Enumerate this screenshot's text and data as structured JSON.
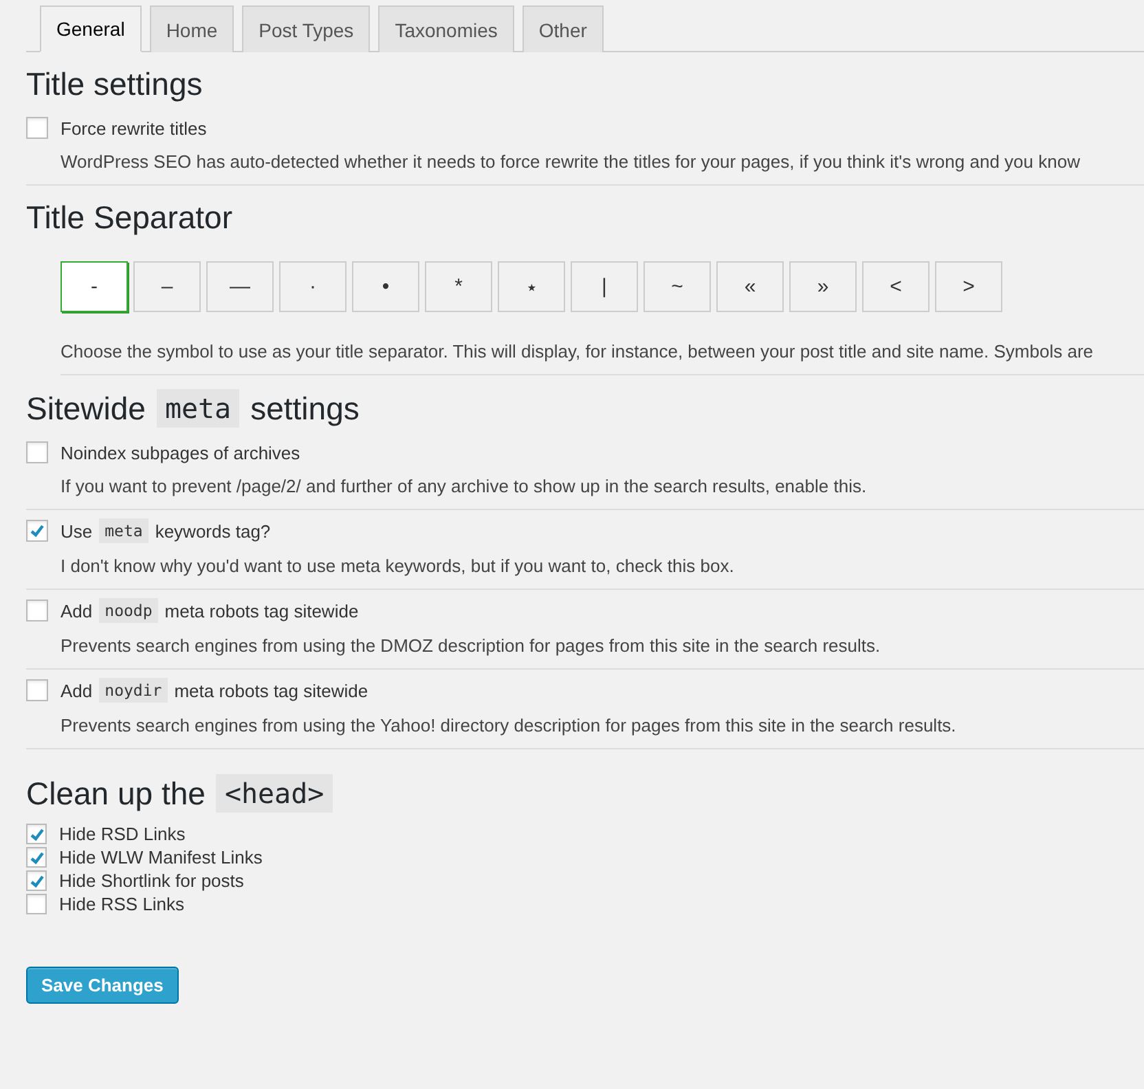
{
  "tabs": [
    {
      "label": "General",
      "selected": true
    },
    {
      "label": "Home",
      "selected": false
    },
    {
      "label": "Post Types",
      "selected": false
    },
    {
      "label": "Taxonomies",
      "selected": false
    },
    {
      "label": "Other",
      "selected": false
    }
  ],
  "sections": [
    {
      "kind": "options",
      "heading": [
        {
          "kind": "text",
          "text": "Title settings"
        }
      ],
      "options": [
        {
          "checked": false,
          "label": [
            {
              "kind": "text",
              "text": "Force rewrite titles"
            }
          ],
          "description": "WordPress SEO has auto-detected whether it needs to force rewrite the titles for your pages, if you think it's wrong and you know"
        }
      ]
    },
    {
      "kind": "separator",
      "heading": [
        {
          "kind": "text",
          "text": "Title Separator"
        }
      ],
      "symbols": [
        {
          "label": "-",
          "selected": true
        },
        {
          "label": "–",
          "selected": false
        },
        {
          "label": "—",
          "selected": false
        },
        {
          "label": "·",
          "selected": false
        },
        {
          "label": "•",
          "selected": false
        },
        {
          "label": "*",
          "selected": false
        },
        {
          "label": "⋆",
          "selected": false
        },
        {
          "label": "|",
          "selected": false
        },
        {
          "label": "~",
          "selected": false
        },
        {
          "label": "«",
          "selected": false
        },
        {
          "label": "»",
          "selected": false
        },
        {
          "label": "<",
          "selected": false
        },
        {
          "label": ">",
          "selected": false
        }
      ],
      "description": "Choose the symbol to use as your title separator. This will display, for instance, between your post title and site name. Symbols are"
    },
    {
      "kind": "options",
      "heading": [
        {
          "kind": "text",
          "text": "Sitewide"
        },
        {
          "kind": "code",
          "text": "meta"
        },
        {
          "kind": "text",
          "text": "settings"
        }
      ],
      "options": [
        {
          "checked": false,
          "label": [
            {
              "kind": "text",
              "text": "Noindex subpages of archives"
            }
          ],
          "description": "If you want to prevent /page/2/ and further of any archive to show up in the search results, enable this."
        },
        {
          "checked": true,
          "label": [
            {
              "kind": "text",
              "text": "Use"
            },
            {
              "kind": "code",
              "text": "meta"
            },
            {
              "kind": "text",
              "text": "keywords tag?"
            }
          ],
          "description": "I don't know why you'd want to use meta keywords, but if you want to, check this box."
        },
        {
          "checked": false,
          "label": [
            {
              "kind": "text",
              "text": "Add"
            },
            {
              "kind": "code",
              "text": "noodp"
            },
            {
              "kind": "text",
              "text": "meta robots tag sitewide"
            }
          ],
          "description": "Prevents search engines from using the DMOZ description for pages from this site in the search results."
        },
        {
          "checked": false,
          "label": [
            {
              "kind": "text",
              "text": "Add"
            },
            {
              "kind": "code",
              "text": "noydir"
            },
            {
              "kind": "text",
              "text": "meta robots tag sitewide"
            }
          ],
          "description": "Prevents search engines from using the Yahoo! directory description for pages from this site in the search results."
        }
      ]
    },
    {
      "kind": "checklist",
      "heading": [
        {
          "kind": "text",
          "text": "Clean up the"
        },
        {
          "kind": "code",
          "text": "<head>"
        }
      ],
      "options": [
        {
          "checked": true,
          "label": "Hide RSD Links"
        },
        {
          "checked": true,
          "label": "Hide WLW Manifest Links"
        },
        {
          "checked": true,
          "label": "Hide Shortlink for posts"
        },
        {
          "checked": false,
          "label": "Hide RSS Links"
        }
      ]
    }
  ],
  "save_button": "Save Changes"
}
